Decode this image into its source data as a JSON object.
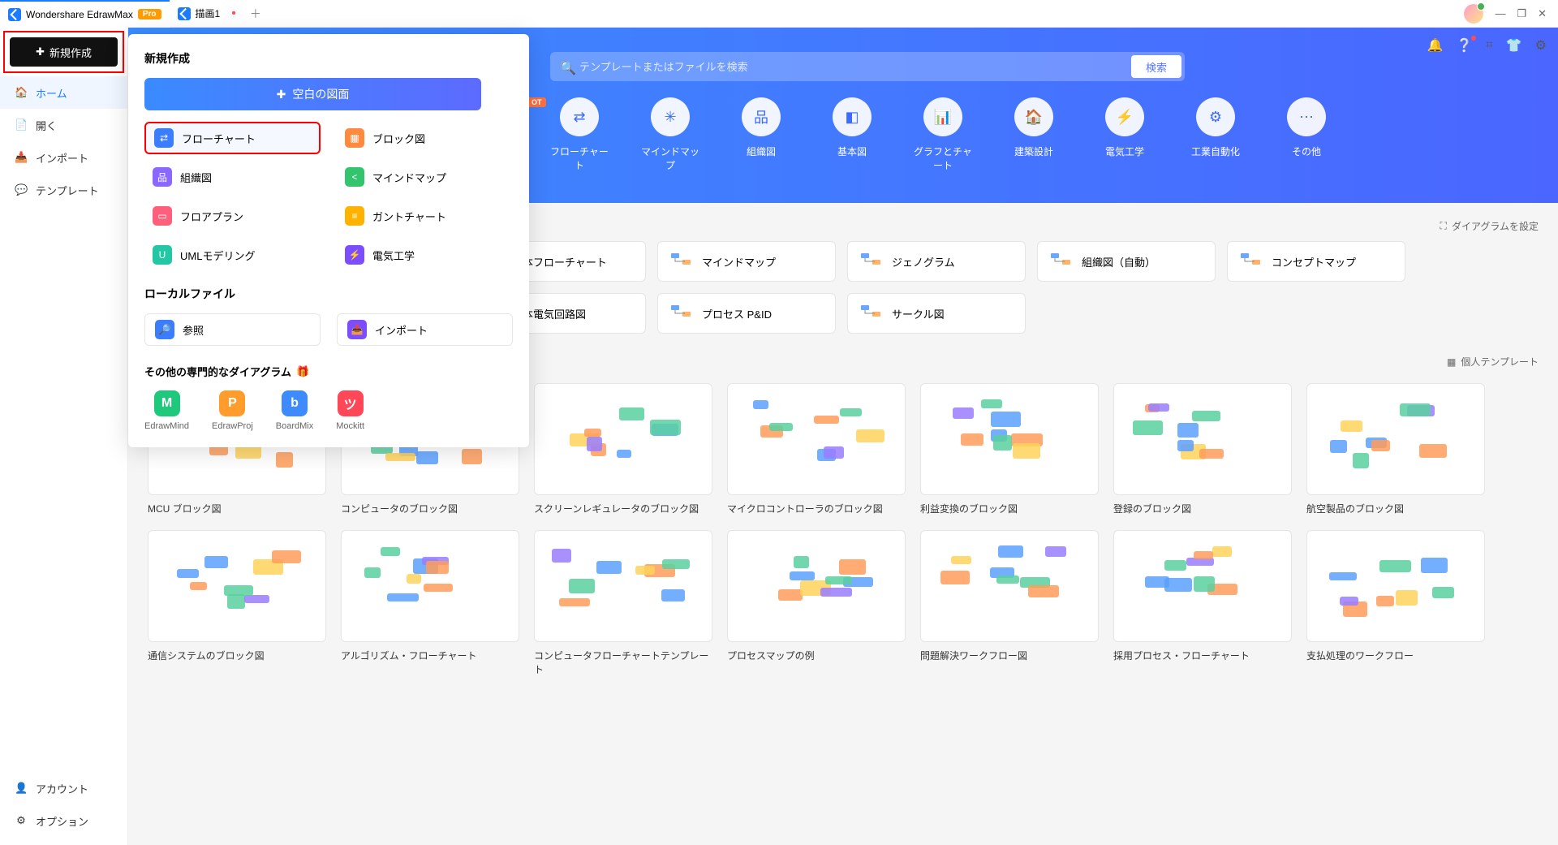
{
  "titlebar": {
    "app_name": "Wondershare EdrawMax",
    "pro_badge": "Pro",
    "tab2": "描画1",
    "new_tab": "＋",
    "win": {
      "min": "—",
      "max": "❐",
      "close": "✕"
    }
  },
  "topright": {
    "bell": "bell",
    "help": "help",
    "apps": "apps",
    "tshirt": "tshirt",
    "gear": "gear"
  },
  "sidebar": {
    "new_btn": "新規作成",
    "items": [
      {
        "icon": "🏠",
        "label": "ホーム"
      },
      {
        "icon": "📄",
        "label": "開く"
      },
      {
        "icon": "📥",
        "label": "インポート"
      },
      {
        "icon": "💬",
        "label": "テンプレート"
      }
    ],
    "footer": [
      {
        "icon": "👤",
        "label": "アカウント"
      },
      {
        "icon": "⚙",
        "label": "オプション"
      }
    ]
  },
  "popup": {
    "title": "新規作成",
    "blank_btn": "空白の図面",
    "diagram_types": [
      {
        "color": "#3b7dff",
        "icon": "⇄",
        "label": "フローチャート",
        "highlight": true
      },
      {
        "color": "#ff8a3d",
        "icon": "▦",
        "label": "ブロック図"
      },
      {
        "color": "#8a68ff",
        "icon": "品",
        "label": "組織図"
      },
      {
        "color": "#33c46e",
        "icon": "<",
        "label": "マインドマップ"
      },
      {
        "color": "#ff5f7a",
        "icon": "▭",
        "label": "フロアプラン"
      },
      {
        "color": "#ffb300",
        "icon": "≡",
        "label": "ガントチャート"
      },
      {
        "color": "#23c7a5",
        "icon": "U",
        "label": "UMLモデリング"
      },
      {
        "color": "#7c4dff",
        "icon": "⚡",
        "label": "電気工学"
      }
    ],
    "local_title": "ローカルファイル",
    "local_buttons": [
      {
        "color": "#3b7dff",
        "icon": "🔎",
        "label": "参照"
      },
      {
        "color": "#7c4dff",
        "icon": "📥",
        "label": "インポート"
      }
    ],
    "other_title": "その他の専門的なダイアグラム",
    "apps": [
      {
        "color": "#1fc97c",
        "icon": "M",
        "label": "EdrawMind"
      },
      {
        "color": "#ff9c2c",
        "icon": "P",
        "label": "EdrawProj"
      },
      {
        "color": "#3e8bff",
        "icon": "b",
        "label": "BoardMix"
      },
      {
        "color": "#ff4757",
        "icon": "ツ",
        "label": "Mockitt"
      }
    ]
  },
  "main": {
    "search_placeholder": "テンプレートまたはファイルを検索",
    "search_btn": "検索",
    "hot": "OT",
    "categories": [
      "フローチャート",
      "マインドマップ",
      "組織図",
      "基本図",
      "グラフとチャート",
      "建築設計",
      "電気工学",
      "工業自動化",
      "その他"
    ],
    "diagram_settings": "ダイアグラムを設定",
    "types_row1": [
      "基本フローチャート",
      "マインドマップ",
      "ジェノグラム",
      "組織図（自動）",
      "コンセプトマップ"
    ],
    "types_row2": [
      "基本電気回路図",
      "プロセス P&ID",
      "サークル図"
    ],
    "personal_templates": "個人テンプレート",
    "templates_row1": [
      "MCU ブロック図",
      "コンピュータのブロック図",
      "スクリーンレギュレータのブロック図",
      "マイクロコントローラのブロック図",
      "利益変換のブロック図",
      "登録のブロック図",
      "航空製品のブロック図"
    ],
    "templates_row2": [
      "通信システムのブロック図",
      "アルゴリズム・フローチャート",
      "コンピュータフローチャートテンプレート",
      "プロセスマップの例",
      "問題解決ワークフロー図",
      "採用プロセス・フローチャート",
      "支払処理のワークフロー"
    ]
  }
}
